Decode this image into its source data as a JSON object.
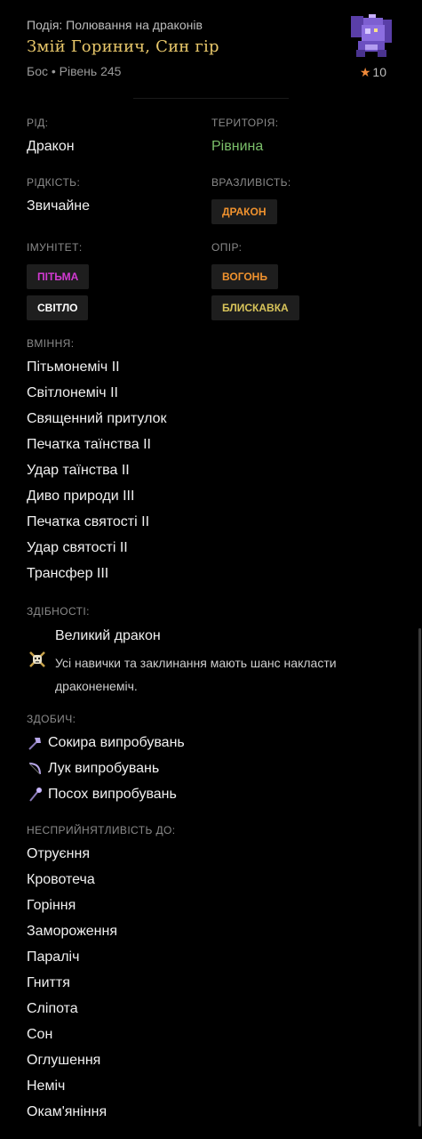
{
  "header": {
    "event": "Подія: Полювання на драконів",
    "title": "Змій Горинич, Син гір",
    "subtitle": "Бос • Рівень 245",
    "stars": "10"
  },
  "stats": {
    "race_label": "РІД:",
    "race_value": "Дракон",
    "territory_label": "ТЕРИТОРІЯ:",
    "territory_value": "Рівнина",
    "rarity_label": "РІДКІСТЬ:",
    "rarity_value": "Звичайне",
    "weakness_label": "ВРАЗЛИВІСТЬ:",
    "weakness_tags": [
      "ДРАКОН"
    ],
    "immunity_label": "ІМУНІТЕТ:",
    "immunity_tags": [
      "ПІТЬМА",
      "СВІТЛО"
    ],
    "resist_label": "ОПІР:",
    "resist_tags": [
      "ВОГОНЬ",
      "БЛИСКАВКА"
    ]
  },
  "skills": {
    "label": "ВМІННЯ:",
    "items": [
      "Пітьмонеміч II",
      "Світлонеміч II",
      "Священний притулок",
      "Печатка таїнства II",
      "Удар таїнства II",
      "Диво природи III",
      "Печатка святості II",
      "Удар святості II",
      "Трансфер III"
    ]
  },
  "abilities": {
    "label": "ЗДІБНОСТІ:",
    "name": "Великий дракон",
    "description": "Усі навички та заклинання мають шанс накласти драконенеміч."
  },
  "loot": {
    "label": "ЗДОБИЧ:",
    "items": [
      "Сокира випробувань",
      "Лук випробувань",
      "Посох випробувань"
    ],
    "icons": [
      "axe-icon",
      "bow-icon",
      "staff-icon"
    ]
  },
  "immunities": {
    "label": "НЕСПРИЙНЯТЛИВІСТЬ ДО:",
    "items": [
      "Отруєння",
      "Кровотеча",
      "Горіння",
      "Замороження",
      "Параліч",
      "Гниття",
      "Сліпота",
      "Сон",
      "Оглушення",
      "Неміч",
      "Окам'яніння"
    ]
  },
  "colors": {
    "title": "#e8c76a",
    "territory": "#7bbf6a",
    "dragon_tag": "#f0922e",
    "dark_tag": "#d33ad3",
    "light_tag": "#ffffff",
    "fire_tag": "#f0922e",
    "lightning_tag": "#d8c45a"
  }
}
